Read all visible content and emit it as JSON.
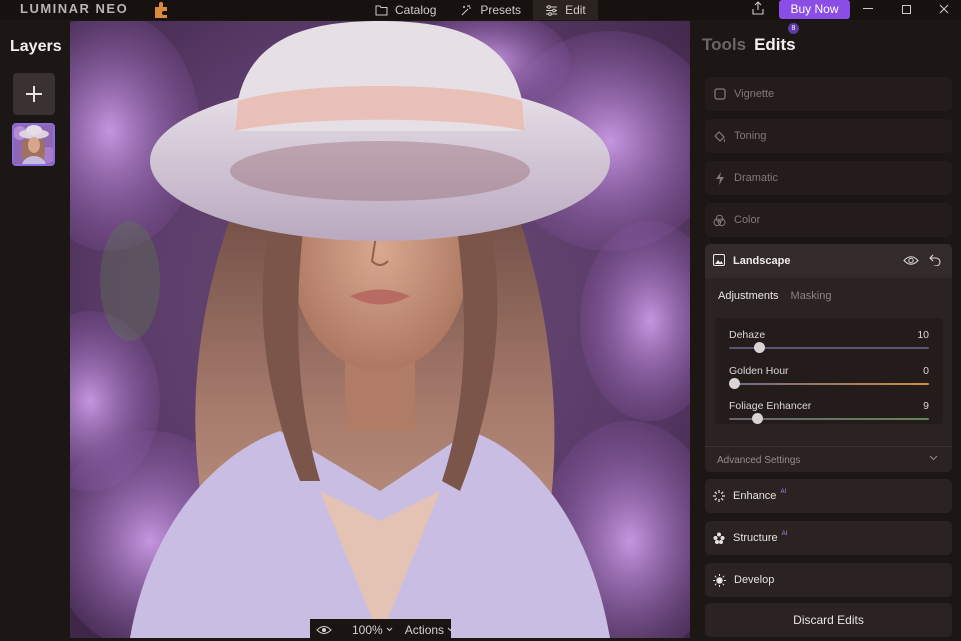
{
  "app": {
    "logo_text": "LUMINAR NEO"
  },
  "nav": {
    "catalog": "Catalog",
    "presets": "Presets",
    "edit": "Edit"
  },
  "buy": {
    "label": "Buy Now",
    "badge": "8"
  },
  "layers": {
    "title": "Layers"
  },
  "panel_tabs": {
    "tools": "Tools",
    "edits": "Edits"
  },
  "tools": [
    {
      "label": "Vignette",
      "icon": "vignette-icon"
    },
    {
      "label": "Toning",
      "icon": "bucket-icon"
    },
    {
      "label": "Dramatic",
      "icon": "bolt-icon"
    },
    {
      "label": "Color",
      "icon": "color-circles-icon"
    }
  ],
  "landscape": {
    "title": "Landscape",
    "subtabs": {
      "adjustments": "Adjustments",
      "masking": "Masking"
    },
    "sliders": [
      {
        "label": "Dehaze",
        "value": "10",
        "fraction": 0.13,
        "color": "#6f6a8a"
      },
      {
        "label": "Golden Hour",
        "value": "0",
        "fraction": 0.0,
        "color": "#c9803f"
      },
      {
        "label": "Foliage Enhancer",
        "value": "9",
        "fraction": 0.12,
        "color": "#5a7d55"
      }
    ],
    "advanced": "Advanced Settings"
  },
  "ai_tools": [
    {
      "label": "Enhance",
      "tag": "AI",
      "icon": "sparkle-icon"
    },
    {
      "label": "Structure",
      "tag": "AI",
      "icon": "structure-icon"
    },
    {
      "label": "Develop",
      "tag": "",
      "icon": "sun-icon"
    }
  ],
  "discard": "Discard Edits",
  "bottom_bar": {
    "zoom": "100%",
    "actions": "Actions"
  }
}
